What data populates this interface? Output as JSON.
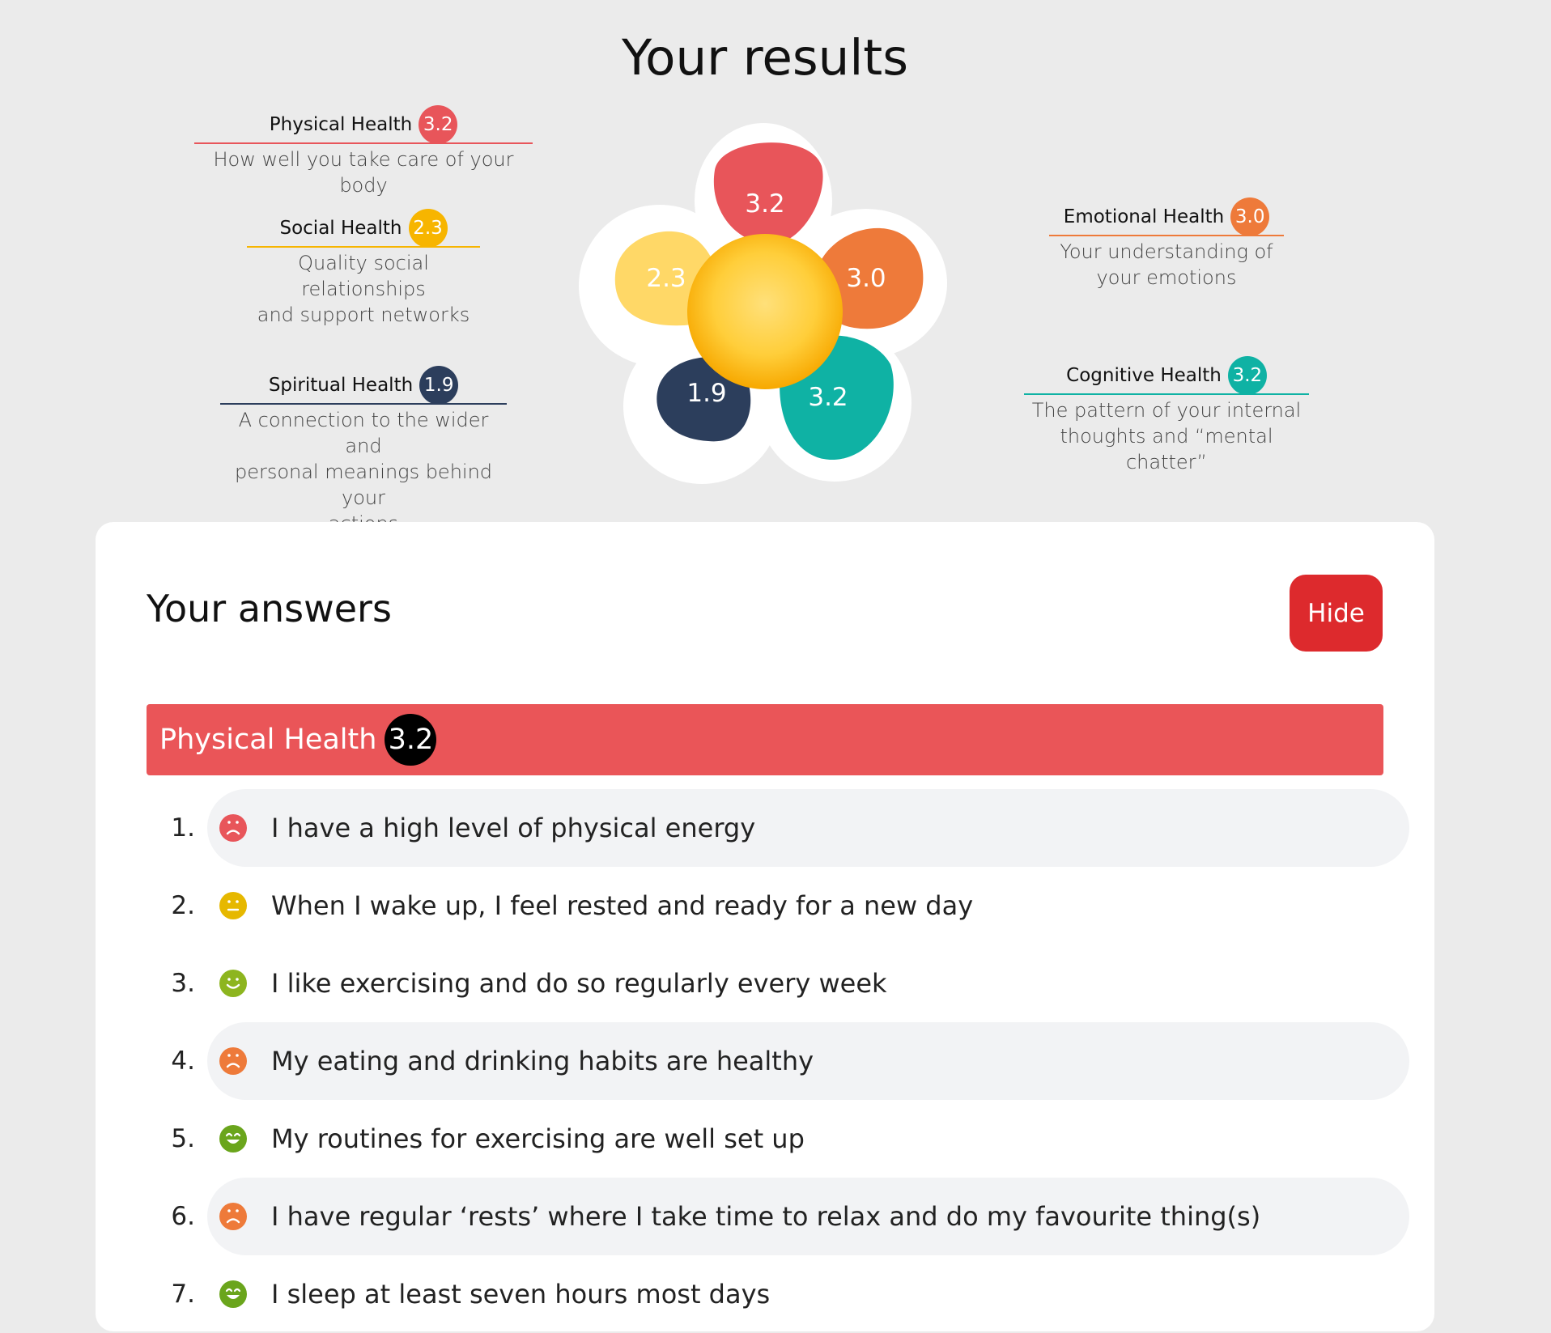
{
  "page": {
    "title": "Your results"
  },
  "colors": {
    "physical": "#e8555a",
    "social": "#f7b500",
    "spiritual": "#2c3e5c",
    "emotional": "#ee7a3a",
    "cognitive": "#0fb2a4"
  },
  "legend": {
    "physical": {
      "name": "Physical Health",
      "score": "3.2",
      "desc": "How well you take care of your body"
    },
    "social": {
      "name": "Social Health",
      "score": "2.3",
      "desc_1": "Quality social relationships",
      "desc_2": "and support networks"
    },
    "spiritual": {
      "name": "Spiritual Health",
      "score": "1.9",
      "desc_1": "A connection to the wider and",
      "desc_2": "personal meanings behind your",
      "desc_3": "actions"
    },
    "emotional": {
      "name": "Emotional Health",
      "score": "3.0",
      "desc_1": "Your understanding of",
      "desc_2": "your emotions"
    },
    "cognitive": {
      "name": "Cognitive Health",
      "score": "3.2",
      "desc_1": "The pattern of your internal",
      "desc_2": "thoughts and “mental chatter”"
    }
  },
  "flower": {
    "physical": "3.2",
    "emotional": "3.0",
    "cognitive": "3.2",
    "spiritual": "1.9",
    "social": "2.3"
  },
  "answers": {
    "title": "Your answers",
    "hide_label": "Hide",
    "category": {
      "name": "Physical Health",
      "score": "3.2"
    },
    "questions": [
      {
        "num": "1.",
        "text": "I have a high level of physical energy",
        "mood": "sad",
        "mood_color": "#e8555a",
        "shaded": true
      },
      {
        "num": "2.",
        "text": "When I wake up, I feel rested and ready for a new day",
        "mood": "neutral",
        "mood_color": "#e6b800",
        "shaded": false
      },
      {
        "num": "3.",
        "text": "I like exercising and do so regularly every week",
        "mood": "smile",
        "mood_color": "#8db51f",
        "shaded": false
      },
      {
        "num": "4.",
        "text": "My eating and drinking habits are healthy",
        "mood": "sad",
        "mood_color": "#ee7a3a",
        "shaded": true
      },
      {
        "num": "5.",
        "text": "My routines for exercising are well set up",
        "mood": "grin",
        "mood_color": "#6aa51c",
        "shaded": false
      },
      {
        "num": "6.",
        "text": "I have regular ‘rests’ where I take time to relax and do my favourite thing(s)",
        "mood": "sad",
        "mood_color": "#ee7a3a",
        "shaded": true
      },
      {
        "num": "7.",
        "text": "I sleep at least seven hours most days",
        "mood": "grin",
        "mood_color": "#6aa51c",
        "shaded": false
      }
    ]
  }
}
